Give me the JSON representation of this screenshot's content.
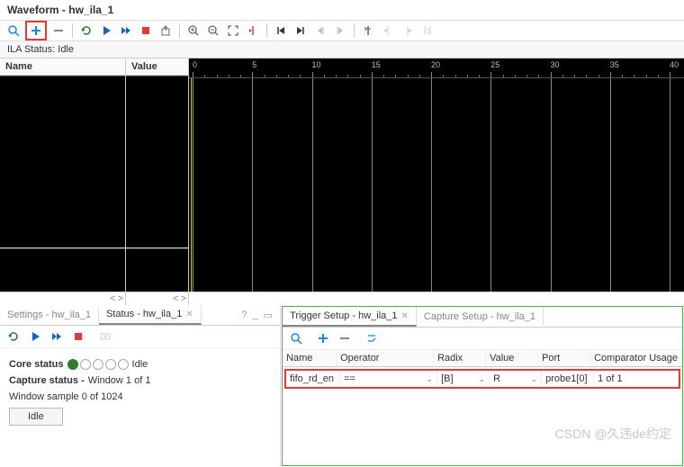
{
  "title": "Waveform - hw_ila_1",
  "ila_status": "ILA Status: Idle",
  "columns": {
    "name": "Name",
    "value": "Value"
  },
  "ruler": {
    "ticks": [
      "0",
      "5",
      "10",
      "15",
      "20",
      "25",
      "30",
      "35",
      "40"
    ]
  },
  "left_panel": {
    "tabs": [
      {
        "label": "Settings - hw_ila_1",
        "active": false
      },
      {
        "label": "Status - hw_ila_1",
        "active": true
      }
    ],
    "core_status_label": "Core status",
    "core_status_value": "Idle",
    "capture_status_label": "Capture status -",
    "capture_status_value": "Window 1 of 1",
    "window_sample": "Window sample 0 of 1024",
    "idle_button": "Idle"
  },
  "right_panel": {
    "tabs": [
      {
        "label": "Trigger Setup - hw_ila_1",
        "active": true
      },
      {
        "label": "Capture Setup - hw_ila_1",
        "active": false
      }
    ],
    "headers": {
      "name": "Name",
      "op": "Operator",
      "radix": "Radix",
      "value": "Value",
      "port": "Port",
      "cu": "Comparator Usage"
    },
    "row": {
      "name": "fifo_rd_en",
      "op": "==",
      "radix": "[B]",
      "value": "R",
      "port": "probe1[0]",
      "cu": "1 of 1"
    }
  },
  "watermark": "CSDN @久违de约定"
}
